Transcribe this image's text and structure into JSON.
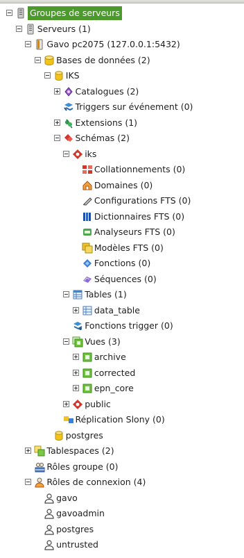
{
  "tree": [
    {
      "label": "Groupes de serveurs",
      "icon": "server-group-icon",
      "level": 0,
      "toggle": "minus",
      "selected": true
    },
    {
      "label": "Serveurs (1)",
      "icon": "servers-icon",
      "level": 1,
      "toggle": "minus"
    },
    {
      "label": "Gavo pc2075 (127.0.0.1:5432)",
      "icon": "server-icon",
      "level": 2,
      "toggle": "minus"
    },
    {
      "label": "Bases de données (2)",
      "icon": "databases-icon",
      "level": 3,
      "toggle": "minus"
    },
    {
      "label": "IKS",
      "icon": "database-icon",
      "level": 4,
      "toggle": "minus"
    },
    {
      "label": "Catalogues (2)",
      "icon": "catalogs-icon",
      "level": 5,
      "toggle": "plus"
    },
    {
      "label": "Triggers sur événement (0)",
      "icon": "event-trigger-icon",
      "level": 5,
      "toggle": null
    },
    {
      "label": "Extensions (1)",
      "icon": "extensions-icon",
      "level": 5,
      "toggle": "plus"
    },
    {
      "label": "Schémas (2)",
      "icon": "schemas-icon",
      "level": 5,
      "toggle": "minus"
    },
    {
      "label": "iks",
      "icon": "schema-icon",
      "level": 6,
      "toggle": "minus"
    },
    {
      "label": "Collationnements (0)",
      "icon": "collation-icon",
      "level": 7,
      "toggle": null
    },
    {
      "label": "Domaines (0)",
      "icon": "domain-icon",
      "level": 7,
      "toggle": null
    },
    {
      "label": "Configurations FTS (0)",
      "icon": "fts-config-icon",
      "level": 7,
      "toggle": null
    },
    {
      "label": "Dictionnaires FTS (0)",
      "icon": "fts-dictionary-icon",
      "level": 7,
      "toggle": null
    },
    {
      "label": "Analyseurs FTS (0)",
      "icon": "fts-parser-icon",
      "level": 7,
      "toggle": null
    },
    {
      "label": "Modèles FTS (0)",
      "icon": "fts-template-icon",
      "level": 7,
      "toggle": null
    },
    {
      "label": "Fonctions (0)",
      "icon": "function-icon",
      "level": 7,
      "toggle": null
    },
    {
      "label": "Séquences (0)",
      "icon": "sequence-icon",
      "level": 7,
      "toggle": null
    },
    {
      "label": "Tables (1)",
      "icon": "tables-icon",
      "level": 6,
      "toggle": "minus"
    },
    {
      "label": "data_table",
      "icon": "table-icon",
      "level": 7,
      "toggle": "plus"
    },
    {
      "label": "Fonctions trigger (0)",
      "icon": "trigger-function-icon",
      "level": 6,
      "toggle": null
    },
    {
      "label": "Vues (3)",
      "icon": "views-icon",
      "level": 6,
      "toggle": "minus"
    },
    {
      "label": "archive",
      "icon": "view-icon",
      "level": 7,
      "toggle": "plus"
    },
    {
      "label": "corrected",
      "icon": "view-icon",
      "level": 7,
      "toggle": "plus"
    },
    {
      "label": "epn_core",
      "icon": "view-icon",
      "level": 7,
      "toggle": "plus"
    },
    {
      "label": "public",
      "icon": "schema-icon",
      "level": 6,
      "toggle": "plus"
    },
    {
      "label": "Réplication Slony (0)",
      "icon": "slony-icon",
      "level": 5,
      "toggle": null
    },
    {
      "label": "postgres",
      "icon": "database-icon",
      "level": 4,
      "toggle": null
    },
    {
      "label": "Tablespaces (2)",
      "icon": "tablespaces-icon",
      "level": 2,
      "toggle": "plus"
    },
    {
      "label": "Rôles groupe (0)",
      "icon": "group-roles-icon",
      "level": 2,
      "toggle": null
    },
    {
      "label": "Rôles de connexion (4)",
      "icon": "login-roles-icon",
      "level": 2,
      "toggle": "minus"
    },
    {
      "label": "gavo",
      "icon": "user-icon",
      "level": 3,
      "toggle": null
    },
    {
      "label": "gavoadmin",
      "icon": "user-icon",
      "level": 3,
      "toggle": null
    },
    {
      "label": "postgres",
      "icon": "user-icon",
      "level": 3,
      "toggle": null
    },
    {
      "label": "untrusted",
      "icon": "user-icon",
      "level": 3,
      "toggle": null
    }
  ],
  "colors": {
    "selection": "#4b9a2b",
    "database": "#f0c419",
    "schema": "#d0362b",
    "view": "#6cc23a",
    "table": "#4a7fc1"
  }
}
